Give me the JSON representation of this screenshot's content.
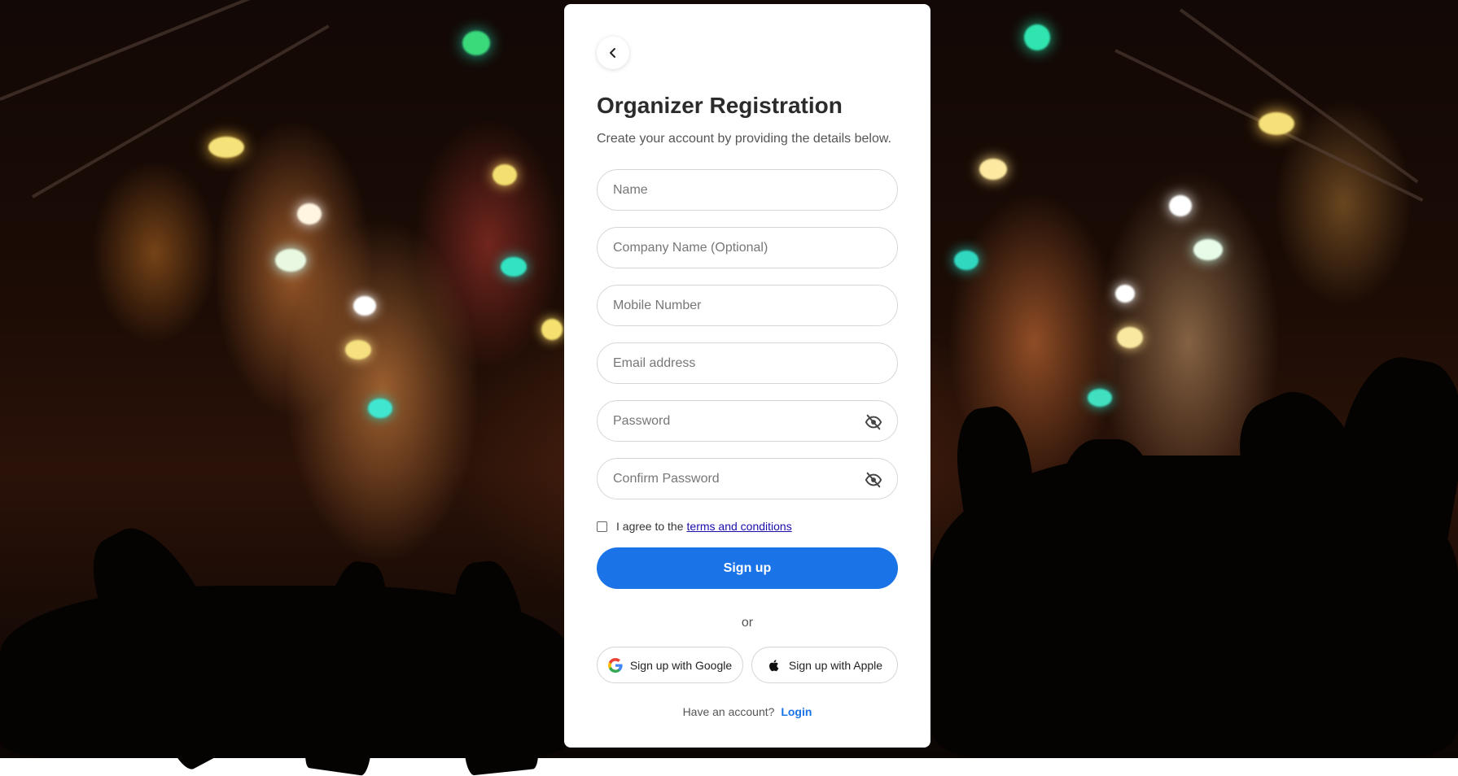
{
  "page": {
    "title": "Organizer Registration",
    "subtitle": "Create your account by providing the details below."
  },
  "form": {
    "name_placeholder": "Name",
    "company_placeholder": "Company Name (Optional)",
    "mobile_placeholder": "Mobile Number",
    "email_placeholder": "Email address",
    "password_placeholder": "Password",
    "confirm_password_placeholder": "Confirm Password",
    "terms_prefix": "I agree to the",
    "terms_link": "terms and conditions",
    "terms_checked": false,
    "signup_label": "Sign up"
  },
  "divider": {
    "or_label": "or"
  },
  "social": {
    "google_label": "Sign up with Google",
    "apple_label": "Sign up with Apple"
  },
  "footer": {
    "prompt": "Have an account?",
    "login_label": "Login"
  },
  "icons": {
    "back": "chevron-left-icon",
    "password_visibility": "eye-off-icon",
    "google": "google-icon",
    "apple": "apple-icon"
  },
  "colors": {
    "primary": "#1b73e8",
    "link": "#1a0dab",
    "card_background": "#ffffff",
    "border": "#d6d6d6"
  },
  "background": {
    "description_icon": "concert-background"
  }
}
